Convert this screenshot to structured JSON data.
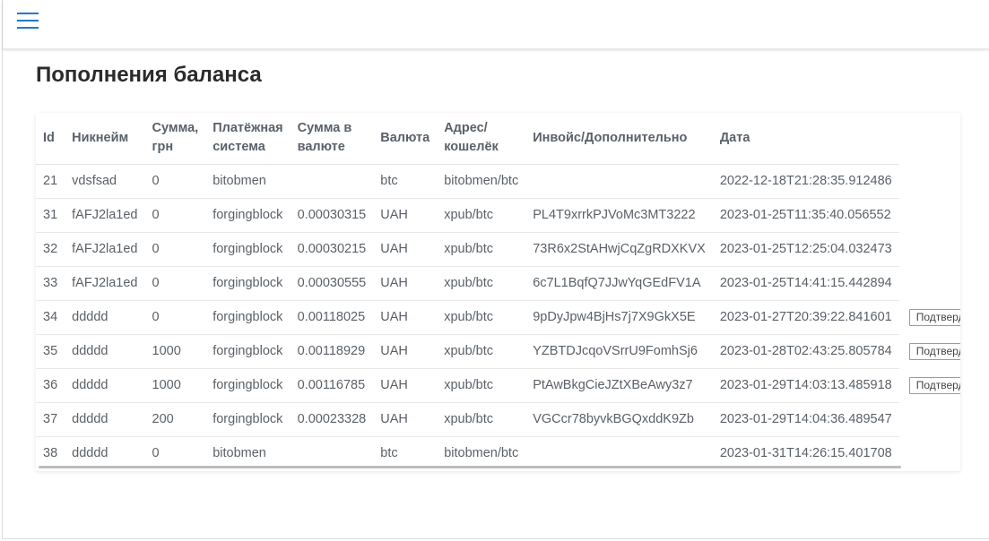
{
  "page": {
    "title": "Пополнения баланса"
  },
  "table": {
    "columns": [
      "Id",
      "Никнейм",
      "Сумма, грн",
      "Платёжная система",
      "Сумма в валюте",
      "Валюта",
      "Адрес/кошелёк",
      "Инвойс/Дополнительно",
      "Дата"
    ],
    "action_label": "Подтвердить",
    "rows": [
      {
        "id": "21",
        "nick": "vdsfsad",
        "sum": "0",
        "pay": "bitobmen",
        "amount": "",
        "currency": "btc",
        "address": "bitobmen/btc",
        "invoice": "",
        "date": "2022-12-18T21:28:35.912486",
        "action": ""
      },
      {
        "id": "31",
        "nick": "fAFJ2la1ed",
        "sum": "0",
        "pay": "forgingblock",
        "amount": "0.00030315",
        "currency": "UAH",
        "address": "xpub/btc",
        "invoice": "PL4T9xrrkPJVoMc3MT3222",
        "date": "2023-01-25T11:35:40.056552",
        "action": ""
      },
      {
        "id": "32",
        "nick": "fAFJ2la1ed",
        "sum": "0",
        "pay": "forgingblock",
        "amount": "0.00030215",
        "currency": "UAH",
        "address": "xpub/btc",
        "invoice": "73R6x2StAHwjCqZgRDXKVX",
        "date": "2023-01-25T12:25:04.032473",
        "action": ""
      },
      {
        "id": "33",
        "nick": "fAFJ2la1ed",
        "sum": "0",
        "pay": "forgingblock",
        "amount": "0.00030555",
        "currency": "UAH",
        "address": "xpub/btc",
        "invoice": "6c7L1BqfQ7JJwYqGEdFV1A",
        "date": "2023-01-25T14:41:15.442894",
        "action": ""
      },
      {
        "id": "34",
        "nick": "ddddd",
        "sum": "0",
        "pay": "forgingblock",
        "amount": "0.00118025",
        "currency": "UAH",
        "address": "xpub/btc",
        "invoice": "9pDyJpw4BjHs7j7X9GkX5E",
        "date": "2023-01-27T20:39:22.841601",
        "action": "Подтвердить"
      },
      {
        "id": "35",
        "nick": "ddddd",
        "sum": "1000",
        "pay": "forgingblock",
        "amount": "0.00118929",
        "currency": "UAH",
        "address": "xpub/btc",
        "invoice": "YZBTDJcqoVSrrU9FomhSj6",
        "date": "2023-01-28T02:43:25.805784",
        "action": "Подтвердить"
      },
      {
        "id": "36",
        "nick": "ddddd",
        "sum": "1000",
        "pay": "forgingblock",
        "amount": "0.00116785",
        "currency": "UAH",
        "address": "xpub/btc",
        "invoice": "PtAwBkgCieJZtXBeAwy3z7",
        "date": "2023-01-29T14:03:13.485918",
        "action": "Подтвердить"
      },
      {
        "id": "37",
        "nick": "ddddd",
        "sum": "200",
        "pay": "forgingblock",
        "amount": "0.00023328",
        "currency": "UAH",
        "address": "xpub/btc",
        "invoice": "VGCcr78byvkBGQxddK9Zb",
        "date": "2023-01-29T14:04:36.489547",
        "action": ""
      },
      {
        "id": "38",
        "nick": "ddddd",
        "sum": "0",
        "pay": "bitobmen",
        "amount": "",
        "currency": "btc",
        "address": "bitobmen/btc",
        "invoice": "",
        "date": "2023-01-31T14:26:15.401708",
        "action": ""
      }
    ]
  },
  "colors": {
    "accent": "#1f7ad1",
    "text": "#5b6168",
    "header_text": "#5a616a"
  },
  "icons": {
    "menu": "hamburger-menu-icon"
  }
}
